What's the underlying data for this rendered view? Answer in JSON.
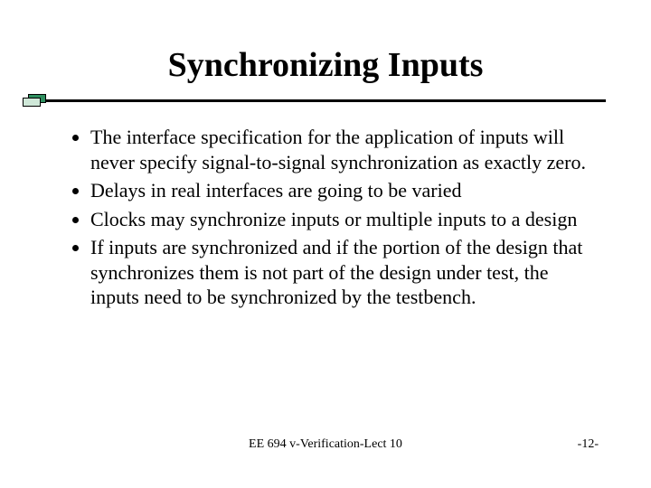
{
  "title": "Synchronizing Inputs",
  "bullets": [
    "The interface specification for the application of inputs will never specify signal-to-signal synchronization as exactly zero.",
    "Delays in real interfaces are going to be varied",
    "Clocks may synchronize inputs or multiple inputs to a design",
    "If inputs are synchronized and if the portion of the design that synchronizes them is not part of the design under test, the inputs need to be synchronized by the testbench."
  ],
  "footer": {
    "center": "EE 694 v-Verification-Lect 10",
    "page": "-12-"
  }
}
